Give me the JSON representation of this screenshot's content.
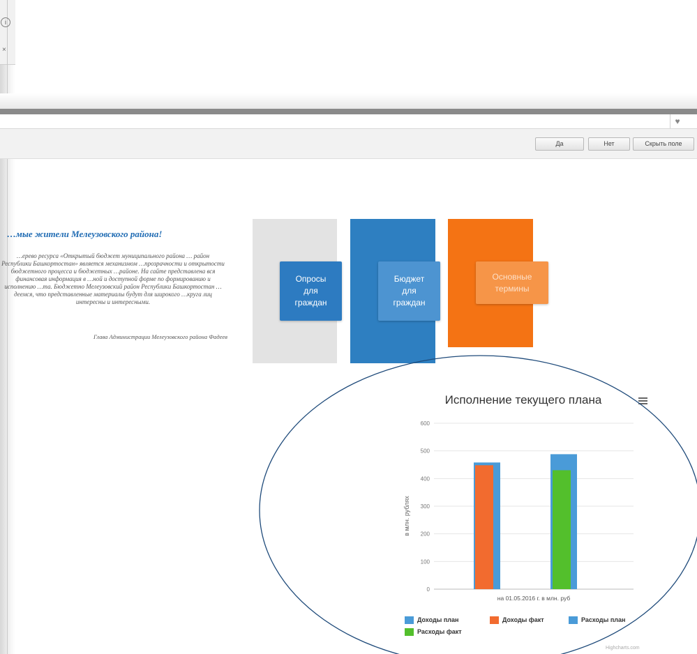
{
  "window": {
    "info_icon": "info-icon",
    "close_glyph": "×"
  },
  "browser": {
    "favorite_icon": "heart-icon",
    "heart_glyph": "♥",
    "buttons": [
      {
        "label": "Да"
      },
      {
        "label": "Нет"
      },
      {
        "label": "Скрыть поле"
      }
    ]
  },
  "greeting": {
    "title": "…мые жители Мелеузовского района!",
    "body": "…ерево ресурса «Открытый бюджет муниципального района … район Республики Башкортостан» является механизмом …прозрачности и открытости бюджетного процесса и бюджетных …районе. На сайте представлена вся финансовая информация в …ной и доступной форме по формированию и исполнению …та. Бюджетно Мелеузовский район Республики Башкортостан …деемся, что представленные материалы будут для широкого …круга лиц интересны и интересными.",
    "signature": "Глава Администрации Мелеузовского района Фадеев"
  },
  "tiles": [
    {
      "line1": "Опросы",
      "line2": "для",
      "line3": "граждан"
    },
    {
      "line1": "Бюджет",
      "line2": "для",
      "line3": "граждан"
    },
    {
      "line1": "Основные",
      "line2": "термины",
      "line3": ""
    }
  ],
  "colors": {
    "tile_grey": "#e3e3e3",
    "tile_blue": "#2e7fc1",
    "tile_orange": "#f47314",
    "income_plan": "#4a9bd8",
    "income_fact": "#f26b2f",
    "expense_plan": "#4a9bd8",
    "expense_fact": "#53bf2c",
    "annotation": "#1e4a7a"
  },
  "chart_data": {
    "type": "bar",
    "title": "Исполнение текущего плана",
    "xlabel": "на 01.05.2016 г. в млн. руб",
    "ylabel": "в млн. рублях",
    "ylim": [
      0,
      600
    ],
    "yticks": [
      0,
      100,
      200,
      300,
      400,
      500,
      600
    ],
    "series": [
      {
        "name": "Доходы план",
        "value": 458,
        "color": "#4a9bd8"
      },
      {
        "name": "Доходы факт",
        "value": 448,
        "color": "#f26b2f"
      },
      {
        "name": "Расходы план",
        "value": 488,
        "color": "#4a9bd8"
      },
      {
        "name": "Расходы факт",
        "value": 430,
        "color": "#53bf2c"
      }
    ],
    "legend_position": "bottom",
    "grid": true,
    "credits": "Highcharts.com"
  }
}
